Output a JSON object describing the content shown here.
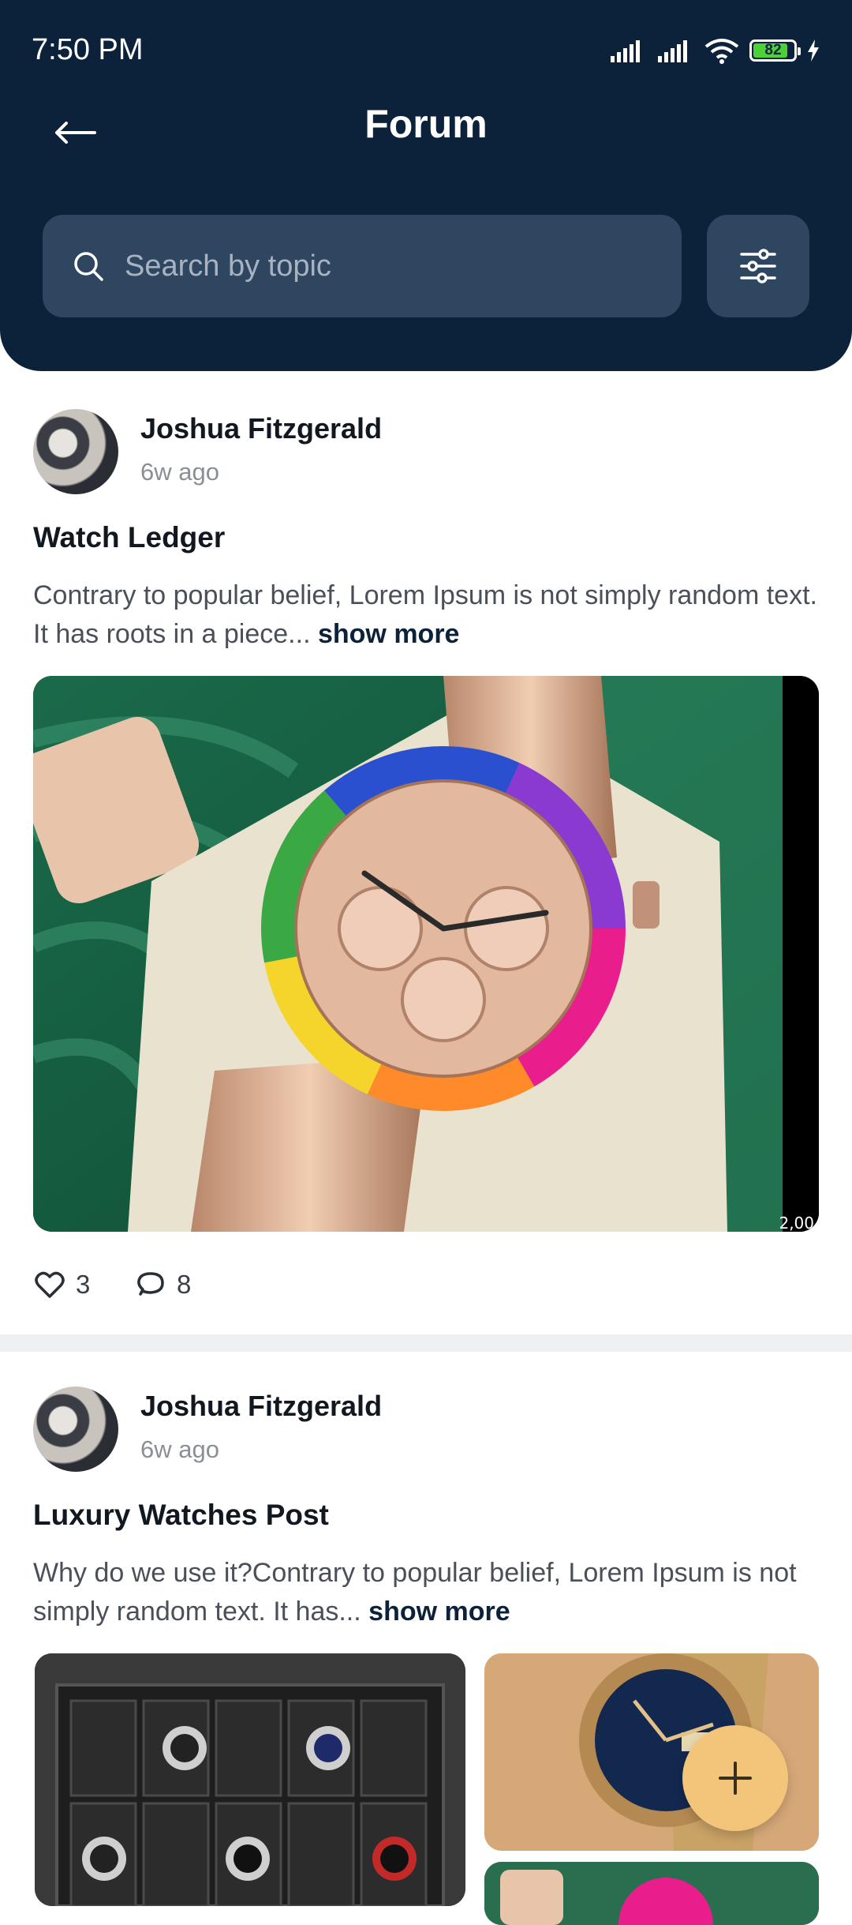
{
  "status_bar": {
    "time": "7:50 PM",
    "battery": "82"
  },
  "header": {
    "title": "Forum",
    "search_placeholder": "Search by topic"
  },
  "posts": [
    {
      "author": "Joshua Fitzgerald",
      "time": "6w ago",
      "title": "Watch Ledger",
      "body": "Contrary to popular belief, Lorem Ipsum is not simply random text. It has roots in a piece...",
      "show_more": "show more",
      "likes": "3",
      "comments": "8",
      "image_label": "2,00"
    },
    {
      "author": "Joshua Fitzgerald",
      "time": "6w ago",
      "title": "Luxury Watches Post",
      "body": "Why do we use it?Contrary to popular belief, Lorem Ipsum is not simply random text. It has...",
      "show_more": "show more"
    }
  ],
  "icons": {
    "back": "arrow-left-icon",
    "search": "search-icon",
    "filter": "sliders-icon",
    "like": "heart-icon",
    "comment": "chat-bubble-icon",
    "fab": "plus-icon"
  },
  "colors": {
    "header_bg": "#0c223a",
    "search_bg": "#2f4660",
    "fab": "#f3c57a"
  }
}
